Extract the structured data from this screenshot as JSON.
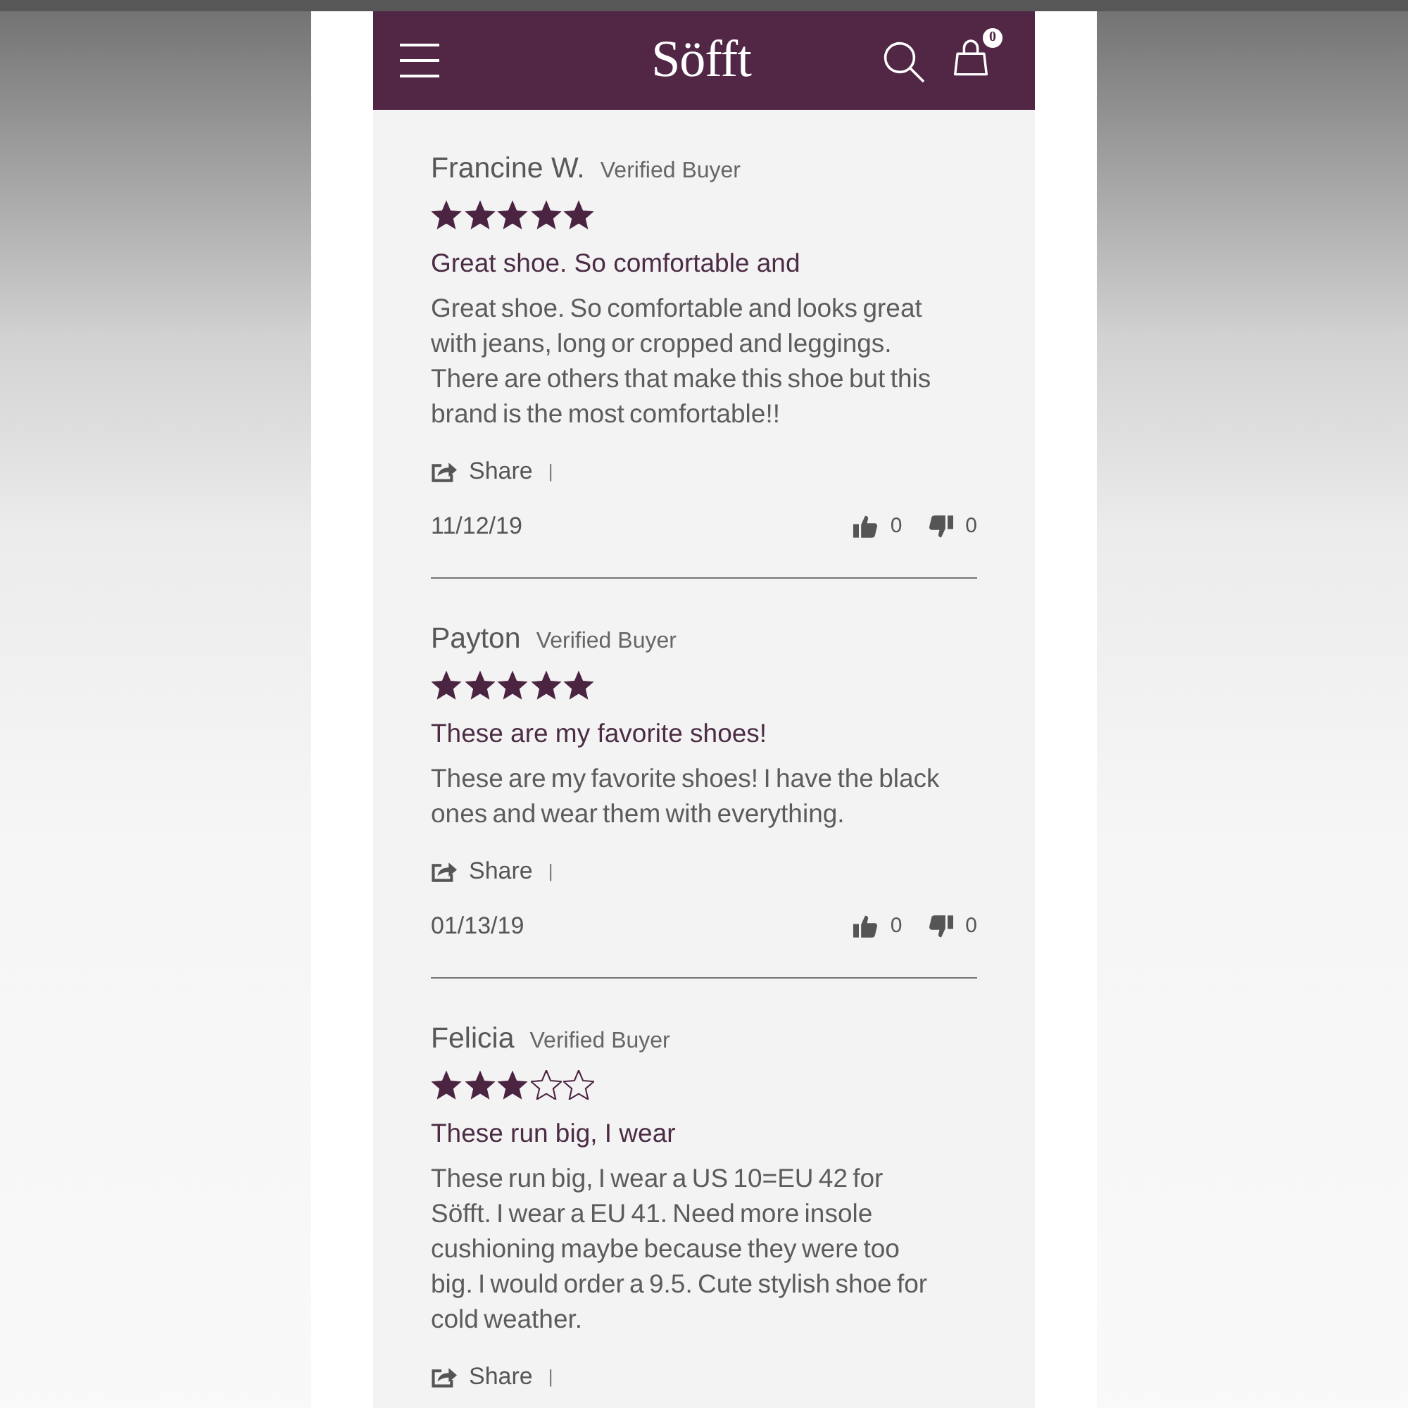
{
  "header": {
    "logo": "Söfft",
    "cart_count": "0"
  },
  "reviews": [
    {
      "author": "Francine W.",
      "badge": "Verified Buyer",
      "stars": 5,
      "title": "Great shoe. So comfortable and",
      "body": "Great shoe. So comfortable and looks great with jeans, long or cropped and leggings. There are others that make this shoe but this brand is the most comfortable!!",
      "share": "Share",
      "separator": "|",
      "date": "11/12/19",
      "helpful": "0",
      "unhelpful": "0"
    },
    {
      "author": "Payton",
      "badge": "Verified Buyer",
      "stars": 5,
      "title": "These are my favorite shoes!",
      "body": "These are my favorite shoes! I have the black ones and wear them with everything.",
      "share": "Share",
      "separator": "|",
      "date": "01/13/19",
      "helpful": "0",
      "unhelpful": "0"
    },
    {
      "author": "Felicia",
      "badge": "Verified Buyer",
      "stars": 3,
      "title": "These run big, I wear",
      "body": "These run big, I wear a US 10=EU 42 for Söfft. I wear a EU 41. Need more insole cushioning maybe because they were too big. I would order a 9.5. Cute stylish shoe for cold weather.",
      "share": "Share",
      "separator": "|"
    }
  ]
}
